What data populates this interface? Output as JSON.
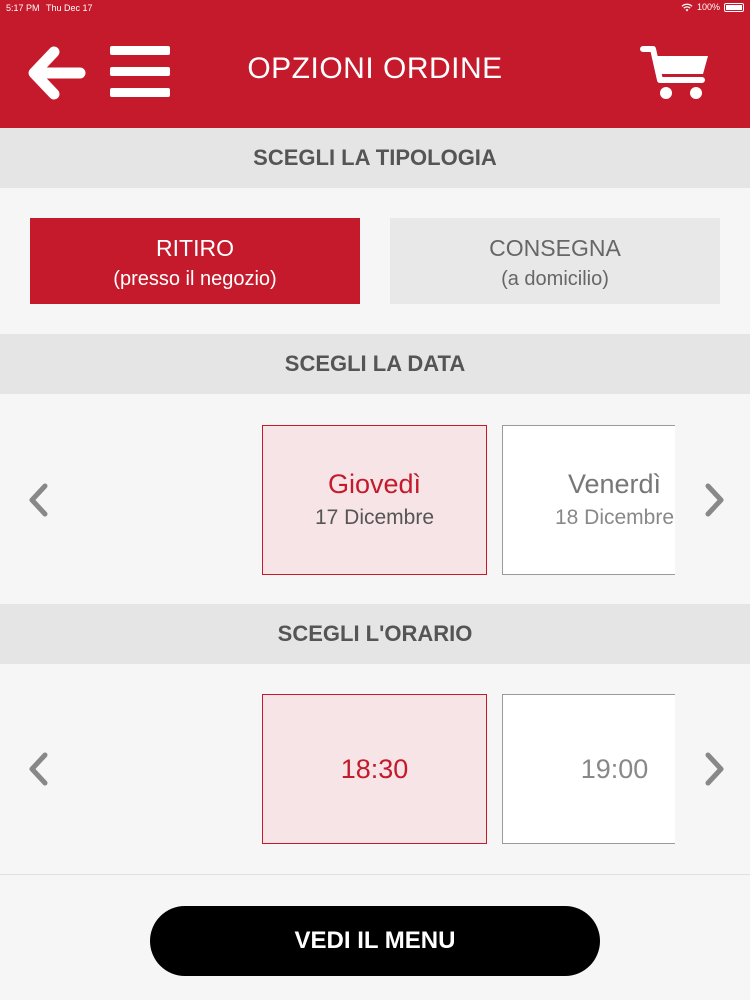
{
  "status_bar": {
    "time": "5:17 PM",
    "date": "Thu Dec 17",
    "battery": "100%"
  },
  "header": {
    "title": "OPZIONI ORDINE",
    "background": "#c41a2c"
  },
  "sections": {
    "type_title": "SCEGLI LA TIPOLOGIA",
    "date_title": "SCEGLI LA DATA",
    "time_title": "SCEGLI L'ORARIO"
  },
  "order_types": [
    {
      "label": "RITIRO",
      "sublabel": "(presso il negozio)",
      "selected": true
    },
    {
      "label": "CONSEGNA",
      "sublabel": "(a domicilio)",
      "selected": false
    }
  ],
  "dates": [
    {
      "day": "Giovedì",
      "date": "17 Dicembre",
      "selected": true
    },
    {
      "day": "Venerdì",
      "date": "18 Dicembre",
      "selected": false
    }
  ],
  "times": [
    {
      "time": "18:30",
      "selected": true
    },
    {
      "time": "19:00",
      "selected": false
    }
  ],
  "cta": {
    "label": "VEDI IL MENU"
  },
  "icons": [
    "back-arrow-icon",
    "hamburger-menu-icon",
    "cart-icon",
    "chevron-left-icon",
    "chevron-right-icon",
    "wifi-icon",
    "battery-icon"
  ]
}
